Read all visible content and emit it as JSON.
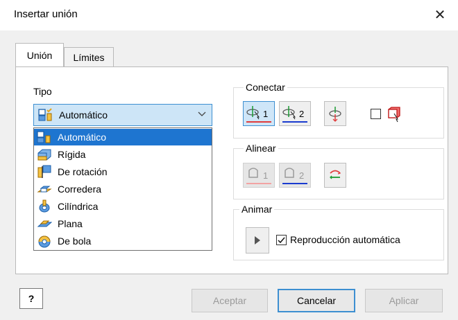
{
  "window": {
    "title": "Insertar unión",
    "close_glyph": "✕"
  },
  "tabs": [
    {
      "label": "Unión",
      "active": true
    },
    {
      "label": "Límites",
      "active": false
    }
  ],
  "tipo": {
    "label": "Tipo",
    "selected": "Automático",
    "options": [
      "Automático",
      "Rígida",
      "De rotación",
      "Corredera",
      "Cilíndrica",
      "Plana",
      "De bola"
    ],
    "highlighted_index": 0
  },
  "conectar": {
    "title": "Conectar",
    "button1_label": "1",
    "button2_label": "2",
    "checkbox_checked": false
  },
  "alinear": {
    "title": "Alinear",
    "button1_label": "1",
    "button2_label": "2"
  },
  "animar": {
    "title": "Animar",
    "autoplay_label": "Reproducción automática",
    "autoplay_checked": true
  },
  "footer": {
    "help_glyph": "?",
    "accept_label": "Aceptar",
    "cancel_label": "Cancelar",
    "apply_label": "Aplicar"
  },
  "colors": {
    "selection": "#1e75d0",
    "pressed_bg": "#cfe6f8",
    "accent_blue": "#3d8fd1",
    "underline_red": "#e03b3b",
    "underline_blue": "#1a3bcf"
  }
}
